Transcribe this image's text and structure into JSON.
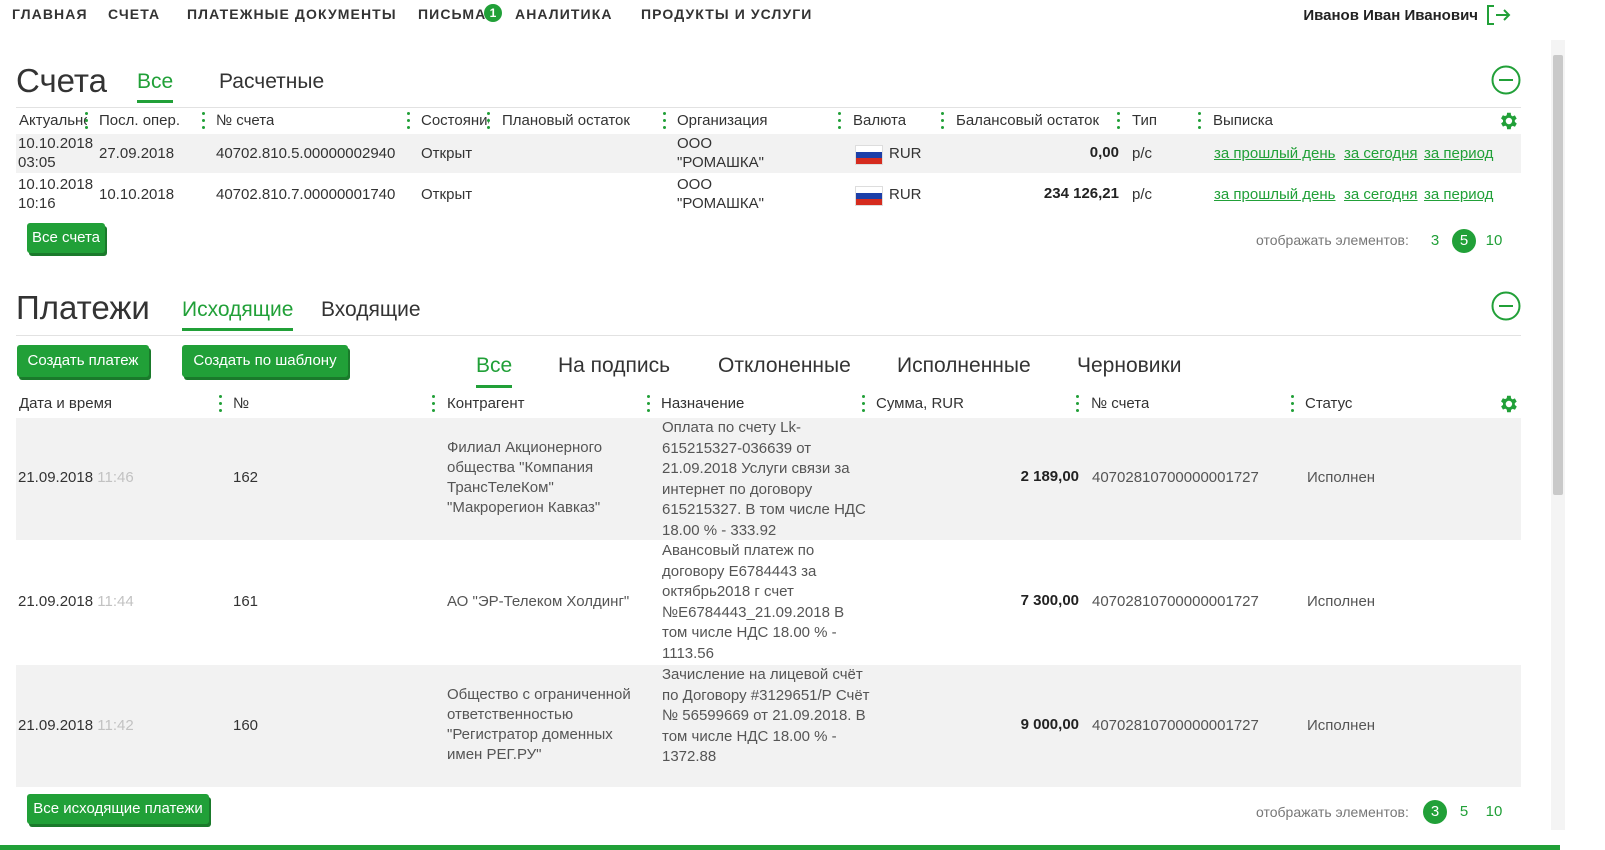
{
  "nav": {
    "items": [
      "Главная",
      "Счета",
      "Платежные документы",
      "Письма",
      "Аналитика",
      "Продукты и услуги"
    ],
    "letters_badge": "1",
    "user_name": "Иванов Иван Иванович"
  },
  "accounts": {
    "title": "Счета",
    "tabs": [
      "Все",
      "Расчетные"
    ],
    "columns": [
      "Актуальность",
      "Посл. опер.",
      "№ счета",
      "Состояние",
      "Плановый остаток",
      "Организация",
      "Валюта",
      "Балансовый остаток",
      "Тип",
      "Выписка"
    ],
    "rows": [
      {
        "actual_date": "10.10.2018",
        "actual_time": "03:05",
        "last_op": "27.09.2018",
        "number": "40702.810.5.00000002940",
        "status": "Открыт",
        "planned": "",
        "org_line1": "ООО",
        "org_line2": "\"РОМАШКА\"",
        "currency": "RUR",
        "balance": "0,00",
        "type": "р/с",
        "stmt_prev": "за прошлый день",
        "stmt_today": "за сегодня",
        "stmt_period": "за период"
      },
      {
        "actual_date": "10.10.2018",
        "actual_time": "10:16",
        "last_op": "10.10.2018",
        "number": "40702.810.7.00000001740",
        "status": "Открыт",
        "planned": "",
        "org_line1": "ООО",
        "org_line2": "\"РОМАШКА\"",
        "currency": "RUR",
        "balance": "234 126,21",
        "type": "р/с",
        "stmt_prev": "за прошлый день",
        "stmt_today": "за сегодня",
        "stmt_period": "за период"
      }
    ],
    "all_button": "Все счета",
    "pager_label": "отображать элементов:",
    "pager": [
      "3",
      "5",
      "10"
    ],
    "pager_active": "5"
  },
  "payments": {
    "title": "Платежи",
    "tabs": [
      "Исходящие",
      "Входящие"
    ],
    "create_button": "Создать платеж",
    "template_button": "Создать по шаблону",
    "filters": [
      "Все",
      "На подпись",
      "Отклоненные",
      "Исполненные",
      "Черновики"
    ],
    "columns": [
      "Дата и время",
      "№",
      "Контрагент",
      "Назначение",
      "Сумма, RUR",
      "№ счета",
      "Статус"
    ],
    "rows": [
      {
        "date": "21.09.2018",
        "time": "11:46",
        "number": "162",
        "counterparty": "Филиал Акционерного общества \"Компания ТрансТелеКом\" \"Макрорегион Кавказ\"",
        "purpose": "Оплата по счету Lk-615215327-036639 от 21.09.2018 Услуги связи за интернет по договору 615215327. В том числе НДС 18.00 % - 333.92",
        "amount": "2 189,00",
        "account": "40702810700000001727",
        "status": "Исполнен"
      },
      {
        "date": "21.09.2018",
        "time": "11:44",
        "number": "161",
        "counterparty": "АО \"ЭР-Телеком Холдинг\"",
        "purpose": "Авансовый платеж по договору Е6784443 за октябрь2018 г счет №Е6784443_21.09.2018 В том числе НДС 18.00 % - 1113.56",
        "amount": "7 300,00",
        "account": "40702810700000001727",
        "status": "Исполнен"
      },
      {
        "date": "21.09.2018",
        "time": "11:42",
        "number": "160",
        "counterparty": "Общество с ограниченной ответственностью \"Регистратор доменных имен РЕГ.РУ\"",
        "purpose": "Зачисление на лицевой счёт по Договору #3129651/Р Счёт № 56599669 от 21.09.2018. В том числе НДС 18.00 % - 1372.88",
        "amount": "9 000,00",
        "account": "40702810700000001727",
        "status": "Исполнен"
      }
    ],
    "all_button": "Все исходящие платежи",
    "pager_label": "отображать элементов:",
    "pager": [
      "3",
      "5",
      "10"
    ],
    "pager_active": "3"
  },
  "colors": {
    "accent": "#21a038",
    "row_bg": "#f2f2f2"
  },
  "icons": [
    "logout-icon",
    "collapse-icon",
    "gear-icon",
    "flag-ru-icon"
  ]
}
